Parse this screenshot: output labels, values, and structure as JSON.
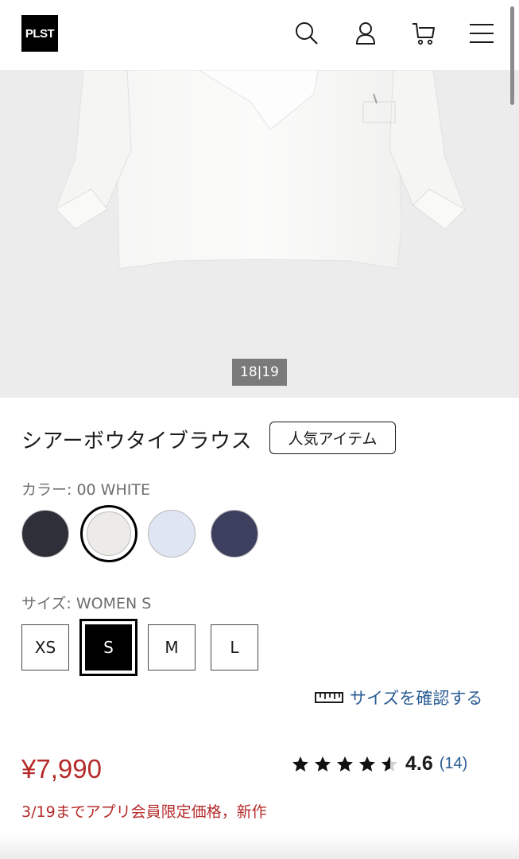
{
  "header": {
    "logo_text": "PLST",
    "icons": [
      "search-icon",
      "user-icon",
      "cart-icon",
      "menu-icon"
    ]
  },
  "gallery": {
    "counter": "18|19"
  },
  "product": {
    "name": "シアーボウタイブラウス",
    "badge": "人気アイテム",
    "color_label": "カラー:",
    "color_value": "00 WHITE",
    "colors": [
      {
        "name": "charcoal",
        "hex": "#2e2f38"
      },
      {
        "name": "white",
        "hex": "#ecebe8",
        "selected": true
      },
      {
        "name": "light-blue",
        "hex": "#dfe5f2"
      },
      {
        "name": "navy",
        "hex": "#3d3f5e"
      }
    ],
    "size_label": "サイズ:",
    "size_value": "WOMEN S",
    "sizes": [
      {
        "label": "XS"
      },
      {
        "label": "S",
        "selected": true
      },
      {
        "label": "M"
      },
      {
        "label": "L"
      }
    ],
    "size_guide": "サイズを確認する",
    "price": "¥7,990",
    "rating_value": "4.6",
    "rating_count": "(14)",
    "rating_stars": 4.6,
    "promo": "3/19までアプリ会員限定価格，新作"
  },
  "colors": {
    "price_red": "#b52a2a",
    "link_blue": "#2b5d93"
  }
}
